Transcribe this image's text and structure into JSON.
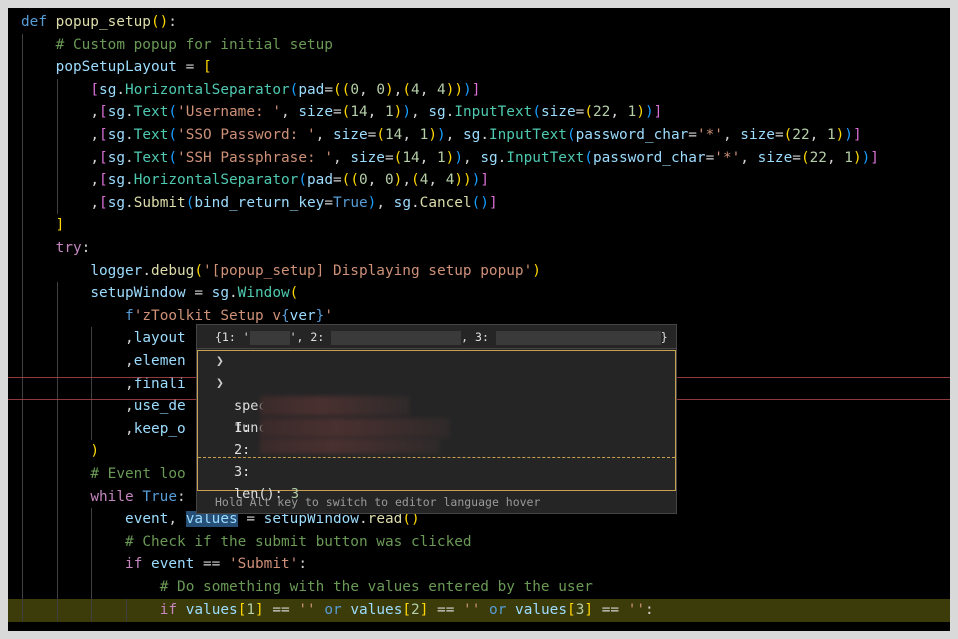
{
  "editor": {
    "lines": [
      {
        "indent": 0,
        "tokens": [
          {
            "c": "kw",
            "t": "def "
          },
          {
            "c": "fn",
            "t": "popup_setup"
          },
          {
            "c": "b1",
            "t": "()"
          },
          {
            "c": "plain",
            "t": ":"
          }
        ]
      },
      {
        "indent": 1,
        "tokens": [
          {
            "c": "cmt",
            "t": "# Custom popup for initial setup"
          }
        ]
      },
      {
        "indent": 1,
        "tokens": [
          {
            "c": "var",
            "t": "popSetupLayout"
          },
          {
            "c": "plain",
            "t": " = "
          },
          {
            "c": "b1",
            "t": "["
          }
        ]
      },
      {
        "indent": 2,
        "tokens": [
          {
            "c": "b2",
            "t": "["
          },
          {
            "c": "var",
            "t": "sg"
          },
          {
            "c": "plain",
            "t": "."
          },
          {
            "c": "cls",
            "t": "HorizontalSeparator"
          },
          {
            "c": "b3",
            "t": "("
          },
          {
            "c": "var",
            "t": "pad"
          },
          {
            "c": "plain",
            "t": "="
          },
          {
            "c": "b1",
            "t": "(("
          },
          {
            "c": "num",
            "t": "0"
          },
          {
            "c": "plain",
            "t": ", "
          },
          {
            "c": "num",
            "t": "0"
          },
          {
            "c": "b1",
            "t": ")"
          },
          {
            "c": "plain",
            "t": ","
          },
          {
            "c": "b1",
            "t": "("
          },
          {
            "c": "num",
            "t": "4"
          },
          {
            "c": "plain",
            "t": ", "
          },
          {
            "c": "num",
            "t": "4"
          },
          {
            "c": "b1",
            "t": "))"
          },
          {
            "c": "b3",
            "t": ")"
          },
          {
            "c": "b2",
            "t": "]"
          }
        ]
      },
      {
        "indent": 2,
        "tokens": [
          {
            "c": "plain",
            "t": ","
          },
          {
            "c": "b2",
            "t": "["
          },
          {
            "c": "var",
            "t": "sg"
          },
          {
            "c": "plain",
            "t": "."
          },
          {
            "c": "cls",
            "t": "Text"
          },
          {
            "c": "b3",
            "t": "("
          },
          {
            "c": "str",
            "t": "'Username: '"
          },
          {
            "c": "plain",
            "t": ", "
          },
          {
            "c": "var",
            "t": "size"
          },
          {
            "c": "plain",
            "t": "="
          },
          {
            "c": "b1",
            "t": "("
          },
          {
            "c": "num",
            "t": "14"
          },
          {
            "c": "plain",
            "t": ", "
          },
          {
            "c": "num",
            "t": "1"
          },
          {
            "c": "b1",
            "t": ")"
          },
          {
            "c": "b3",
            "t": ")"
          },
          {
            "c": "plain",
            "t": ", "
          },
          {
            "c": "var",
            "t": "sg"
          },
          {
            "c": "plain",
            "t": "."
          },
          {
            "c": "cls",
            "t": "InputText"
          },
          {
            "c": "b3",
            "t": "("
          },
          {
            "c": "var",
            "t": "size"
          },
          {
            "c": "plain",
            "t": "="
          },
          {
            "c": "b1",
            "t": "("
          },
          {
            "c": "num",
            "t": "22"
          },
          {
            "c": "plain",
            "t": ", "
          },
          {
            "c": "num",
            "t": "1"
          },
          {
            "c": "b1",
            "t": ")"
          },
          {
            "c": "b3",
            "t": ")"
          },
          {
            "c": "b2",
            "t": "]"
          }
        ]
      },
      {
        "indent": 2,
        "tokens": [
          {
            "c": "plain",
            "t": ","
          },
          {
            "c": "b2",
            "t": "["
          },
          {
            "c": "var",
            "t": "sg"
          },
          {
            "c": "plain",
            "t": "."
          },
          {
            "c": "cls",
            "t": "Text"
          },
          {
            "c": "b3",
            "t": "("
          },
          {
            "c": "str",
            "t": "'SSO Password: '"
          },
          {
            "c": "plain",
            "t": ", "
          },
          {
            "c": "var",
            "t": "size"
          },
          {
            "c": "plain",
            "t": "="
          },
          {
            "c": "b1",
            "t": "("
          },
          {
            "c": "num",
            "t": "14"
          },
          {
            "c": "plain",
            "t": ", "
          },
          {
            "c": "num",
            "t": "1"
          },
          {
            "c": "b1",
            "t": ")"
          },
          {
            "c": "b3",
            "t": ")"
          },
          {
            "c": "plain",
            "t": ", "
          },
          {
            "c": "var",
            "t": "sg"
          },
          {
            "c": "plain",
            "t": "."
          },
          {
            "c": "cls",
            "t": "InputText"
          },
          {
            "c": "b3",
            "t": "("
          },
          {
            "c": "var",
            "t": "password_char"
          },
          {
            "c": "plain",
            "t": "="
          },
          {
            "c": "str",
            "t": "'*'"
          },
          {
            "c": "plain",
            "t": ", "
          },
          {
            "c": "var",
            "t": "size"
          },
          {
            "c": "plain",
            "t": "="
          },
          {
            "c": "b1",
            "t": "("
          },
          {
            "c": "num",
            "t": "22"
          },
          {
            "c": "plain",
            "t": ", "
          },
          {
            "c": "num",
            "t": "1"
          },
          {
            "c": "b1",
            "t": ")"
          },
          {
            "c": "b3",
            "t": ")"
          },
          {
            "c": "b2",
            "t": "]"
          }
        ]
      },
      {
        "indent": 2,
        "tokens": [
          {
            "c": "plain",
            "t": ","
          },
          {
            "c": "b2",
            "t": "["
          },
          {
            "c": "var",
            "t": "sg"
          },
          {
            "c": "plain",
            "t": "."
          },
          {
            "c": "cls",
            "t": "Text"
          },
          {
            "c": "b3",
            "t": "("
          },
          {
            "c": "str",
            "t": "'SSH Passphrase: '"
          },
          {
            "c": "plain",
            "t": ", "
          },
          {
            "c": "var",
            "t": "size"
          },
          {
            "c": "plain",
            "t": "="
          },
          {
            "c": "b1",
            "t": "("
          },
          {
            "c": "num",
            "t": "14"
          },
          {
            "c": "plain",
            "t": ", "
          },
          {
            "c": "num",
            "t": "1"
          },
          {
            "c": "b1",
            "t": ")"
          },
          {
            "c": "b3",
            "t": ")"
          },
          {
            "c": "plain",
            "t": ", "
          },
          {
            "c": "var",
            "t": "sg"
          },
          {
            "c": "plain",
            "t": "."
          },
          {
            "c": "cls",
            "t": "InputText"
          },
          {
            "c": "b3",
            "t": "("
          },
          {
            "c": "var",
            "t": "password_char"
          },
          {
            "c": "plain",
            "t": "="
          },
          {
            "c": "str",
            "t": "'*'"
          },
          {
            "c": "plain",
            "t": ", "
          },
          {
            "c": "var",
            "t": "size"
          },
          {
            "c": "plain",
            "t": "="
          },
          {
            "c": "b1",
            "t": "("
          },
          {
            "c": "num",
            "t": "22"
          },
          {
            "c": "plain",
            "t": ", "
          },
          {
            "c": "num",
            "t": "1"
          },
          {
            "c": "b1",
            "t": ")"
          },
          {
            "c": "b3",
            "t": ")"
          },
          {
            "c": "b2",
            "t": "]"
          }
        ]
      },
      {
        "indent": 2,
        "tokens": [
          {
            "c": "plain",
            "t": ","
          },
          {
            "c": "b2",
            "t": "["
          },
          {
            "c": "var",
            "t": "sg"
          },
          {
            "c": "plain",
            "t": "."
          },
          {
            "c": "cls",
            "t": "HorizontalSeparator"
          },
          {
            "c": "b3",
            "t": "("
          },
          {
            "c": "var",
            "t": "pad"
          },
          {
            "c": "plain",
            "t": "="
          },
          {
            "c": "b1",
            "t": "(("
          },
          {
            "c": "num",
            "t": "0"
          },
          {
            "c": "plain",
            "t": ", "
          },
          {
            "c": "num",
            "t": "0"
          },
          {
            "c": "b1",
            "t": ")"
          },
          {
            "c": "plain",
            "t": ","
          },
          {
            "c": "b1",
            "t": "("
          },
          {
            "c": "num",
            "t": "4"
          },
          {
            "c": "plain",
            "t": ", "
          },
          {
            "c": "num",
            "t": "4"
          },
          {
            "c": "b1",
            "t": "))"
          },
          {
            "c": "b3",
            "t": ")"
          },
          {
            "c": "b2",
            "t": "]"
          }
        ]
      },
      {
        "indent": 2,
        "tokens": [
          {
            "c": "plain",
            "t": ","
          },
          {
            "c": "b2",
            "t": "["
          },
          {
            "c": "var",
            "t": "sg"
          },
          {
            "c": "plain",
            "t": "."
          },
          {
            "c": "fn",
            "t": "Submit"
          },
          {
            "c": "b3",
            "t": "("
          },
          {
            "c": "var",
            "t": "bind_return_key"
          },
          {
            "c": "plain",
            "t": "="
          },
          {
            "c": "kw",
            "t": "True"
          },
          {
            "c": "b3",
            "t": ")"
          },
          {
            "c": "plain",
            "t": ", "
          },
          {
            "c": "var",
            "t": "sg"
          },
          {
            "c": "plain",
            "t": "."
          },
          {
            "c": "fn",
            "t": "Cancel"
          },
          {
            "c": "b3",
            "t": "()"
          },
          {
            "c": "b2",
            "t": "]"
          }
        ]
      },
      {
        "indent": 1,
        "tokens": [
          {
            "c": "b1",
            "t": "]"
          }
        ]
      },
      {
        "indent": 1,
        "tokens": [
          {
            "c": "ctrl",
            "t": "try"
          },
          {
            "c": "plain",
            "t": ":"
          }
        ]
      },
      {
        "indent": 2,
        "tokens": [
          {
            "c": "var",
            "t": "logger"
          },
          {
            "c": "plain",
            "t": "."
          },
          {
            "c": "fn",
            "t": "debug"
          },
          {
            "c": "b1",
            "t": "("
          },
          {
            "c": "str",
            "t": "'[popup_setup] Displaying setup popup'"
          },
          {
            "c": "b1",
            "t": ")"
          }
        ]
      },
      {
        "indent": 2,
        "tokens": [
          {
            "c": "var",
            "t": "setupWindow"
          },
          {
            "c": "plain",
            "t": " = "
          },
          {
            "c": "var",
            "t": "sg"
          },
          {
            "c": "plain",
            "t": "."
          },
          {
            "c": "cls",
            "t": "Window"
          },
          {
            "c": "b1",
            "t": "("
          }
        ]
      },
      {
        "indent": 3,
        "tokens": [
          {
            "c": "kw",
            "t": "f"
          },
          {
            "c": "str",
            "t": "'zToolkit Setup v"
          },
          {
            "c": "kw",
            "t": "{"
          },
          {
            "c": "var",
            "t": "ver"
          },
          {
            "c": "kw",
            "t": "}"
          },
          {
            "c": "str",
            "t": "'"
          }
        ]
      },
      {
        "indent": 3,
        "tokens": [
          {
            "c": "plain",
            "t": ","
          },
          {
            "c": "var",
            "t": "layout"
          }
        ]
      },
      {
        "indent": 3,
        "tokens": [
          {
            "c": "plain",
            "t": ","
          },
          {
            "c": "var",
            "t": "elemen"
          }
        ]
      },
      {
        "indent": 3,
        "tokens": [
          {
            "c": "plain",
            "t": ","
          },
          {
            "c": "var",
            "t": "finali"
          }
        ]
      },
      {
        "indent": 3,
        "tokens": [
          {
            "c": "plain",
            "t": ","
          },
          {
            "c": "var",
            "t": "use_de"
          }
        ]
      },
      {
        "indent": 3,
        "tokens": [
          {
            "c": "plain",
            "t": ","
          },
          {
            "c": "var",
            "t": "keep_o"
          }
        ]
      },
      {
        "indent": 2,
        "tokens": [
          {
            "c": "b1",
            "t": ")"
          }
        ]
      },
      {
        "indent": 2,
        "tokens": [
          {
            "c": "cmt",
            "t": "# Event loo"
          }
        ]
      },
      {
        "indent": 2,
        "tokens": [
          {
            "c": "ctrl",
            "t": "while "
          },
          {
            "c": "kw",
            "t": "True"
          },
          {
            "c": "plain",
            "t": ":"
          }
        ]
      },
      {
        "indent": 3,
        "tokens": [
          {
            "c": "var",
            "t": "event"
          },
          {
            "c": "plain",
            "t": ", "
          },
          {
            "c": "var",
            "t": "values"
          },
          {
            "c": "plain",
            "t": " = "
          },
          {
            "c": "var",
            "t": "setupWindow"
          },
          {
            "c": "plain",
            "t": "."
          },
          {
            "c": "fn",
            "t": "read"
          },
          {
            "c": "b1",
            "t": "()"
          }
        ]
      },
      {
        "indent": 3,
        "tokens": [
          {
            "c": "cmt",
            "t": "# Check if the submit button was clicked"
          }
        ]
      },
      {
        "indent": 3,
        "tokens": [
          {
            "c": "ctrl",
            "t": "if "
          },
          {
            "c": "var",
            "t": "event"
          },
          {
            "c": "plain",
            "t": " == "
          },
          {
            "c": "str",
            "t": "'Submit'"
          },
          {
            "c": "plain",
            "t": ":"
          }
        ]
      },
      {
        "indent": 4,
        "tokens": [
          {
            "c": "cmt",
            "t": "# Do something with the values entered by the user"
          }
        ]
      },
      {
        "indent": 4,
        "tokens": [
          {
            "c": "ctrl",
            "t": "if "
          },
          {
            "c": "var",
            "t": "values"
          },
          {
            "c": "b1",
            "t": "["
          },
          {
            "c": "num",
            "t": "1"
          },
          {
            "c": "b1",
            "t": "]"
          },
          {
            "c": "plain",
            "t": " == "
          },
          {
            "c": "str",
            "t": "''"
          },
          {
            "c": "plain",
            "t": " "
          },
          {
            "c": "kw",
            "t": "or "
          },
          {
            "c": "var",
            "t": "values"
          },
          {
            "c": "b1",
            "t": "["
          },
          {
            "c": "num",
            "t": "2"
          },
          {
            "c": "b1",
            "t": "]"
          },
          {
            "c": "plain",
            "t": " == "
          },
          {
            "c": "str",
            "t": "''"
          },
          {
            "c": "plain",
            "t": " "
          },
          {
            "c": "kw",
            "t": "or "
          },
          {
            "c": "var",
            "t": "values"
          },
          {
            "c": "b1",
            "t": "["
          },
          {
            "c": "num",
            "t": "3"
          },
          {
            "c": "b1",
            "t": "]"
          },
          {
            "c": "plain",
            "t": " == "
          },
          {
            "c": "str",
            "t": "''"
          },
          {
            "c": "plain",
            "t": ":"
          }
        ]
      }
    ]
  },
  "hover": {
    "header": {
      "part1": "{1: '",
      "part2": "', 2: ",
      "part3": ", 3: ",
      "part4": "}"
    },
    "tree": {
      "special_variables": "special variables",
      "function_variables": "function variables",
      "key1": "1:",
      "key2": "2:",
      "key3": "3:",
      "len_label": "len(): ",
      "len_value": "3"
    },
    "footer": "Hold Alt key to switch to editor language hover"
  }
}
